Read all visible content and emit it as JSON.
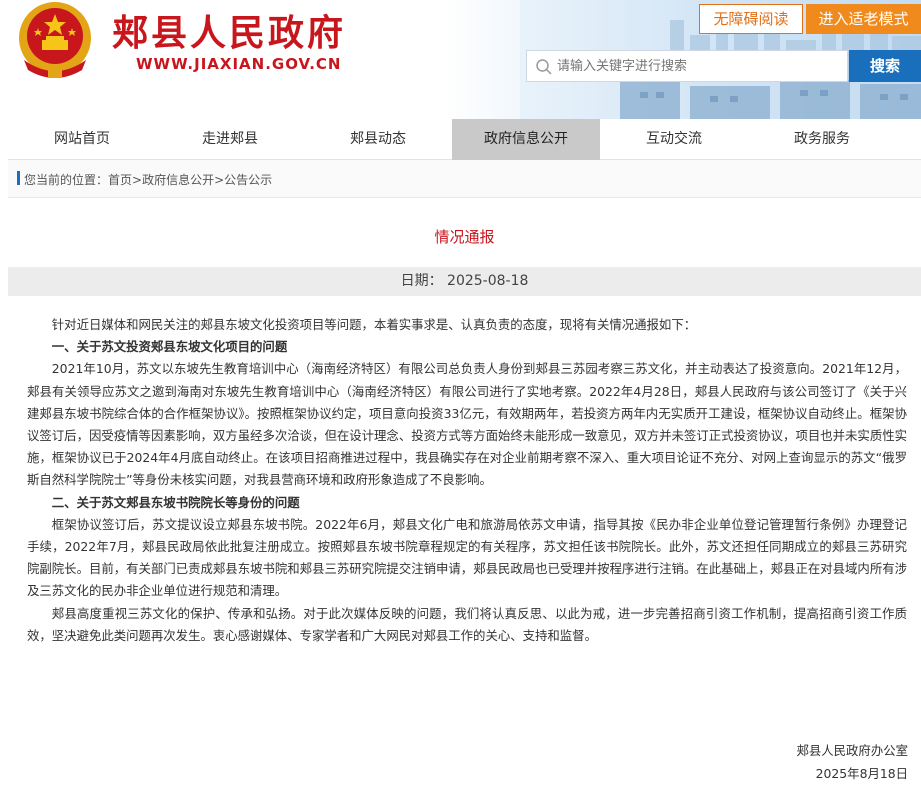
{
  "header": {
    "site_title": "郏县人民政府",
    "site_url": "WWW.JIAXIAN.GOV.CN",
    "accessibility_label": "无障碍阅读",
    "elder_mode_label": "进入适老模式",
    "search_placeholder": "请输入关键字进行搜索",
    "search_button": "搜索"
  },
  "nav": {
    "items": [
      "网站首页",
      "走进郏县",
      "郏县动态",
      "政府信息公开",
      "互动交流",
      "政务服务"
    ],
    "active": "政府信息公开"
  },
  "breadcrumb": {
    "prefix": "您当前的位置：",
    "items": [
      "首页",
      "政府信息公开",
      "公告公示"
    ],
    "separator": ">"
  },
  "article": {
    "title": "情况通报",
    "date": "日期：  2025-08-18",
    "paragraphs": [
      "针对近日媒体和网民关注的郏县东坡文化投资项目等问题，本着实事求是、认真负责的态度，现将有关情况通报如下：",
      "一、关于苏文投资郏县东坡文化项目的问题",
      "2021年10月，苏文以东坡先生教育培训中心（海南经济特区）有限公司总负责人身份到郏县三苏园考察三苏文化，并主动表达了投资意向。2021年12月，郏县有关领导应苏文之邀到海南对东坡先生教育培训中心（海南经济特区）有限公司进行了实地考察。2022年4月28日，郏县人民政府与该公司签订了《关于兴建郏县东坡书院综合体的合作框架协议》。按照框架协议约定，项目意向投资33亿元，有效期两年，若投资方两年内无实质开工建设，框架协议自动终止。框架协议签订后，因受疫情等因素影响，双方虽经多次洽谈，但在设计理念、投资方式等方面始终未能形成一致意见，双方并未签订正式投资协议，项目也并未实质性实施，框架协议已于2024年4月底自动终止。在该项目招商推进过程中，我县确实存在对企业前期考察不深入、重大项目论证不充分、对网上查询显示的苏文“俄罗斯自然科学院院士”等身份未核实问题，对我县营商环境和政府形象造成了不良影响。",
      "二、关于苏文郏县东坡书院院长等身份的问题",
      "框架协议签订后，苏文提议设立郏县东坡书院。2022年6月，郏县文化广电和旅游局依苏文申请，指导其按《民办非企业单位登记管理暂行条例》办理登记手续，2022年7月，郏县民政局依此批复注册成立。按照郏县东坡书院章程规定的有关程序，苏文担任该书院院长。此外，苏文还担任同期成立的郏县三苏研究院副院长。目前，有关部门已责成郏县东坡书院和郏县三苏研究院提交注销申请，郏县民政局也已受理并按程序进行注销。在此基础上，郏县正在对县域内所有涉及三苏文化的民办非企业单位进行规范和清理。",
      "郏县高度重视三苏文化的保护、传承和弘扬。对于此次媒体反映的问题，我们将认真反思、以此为戒，进一步完善招商引资工作机制，提高招商引资工作质效，坚决避免此类问题再次发生。衷心感谢媒体、专家学者和广大网民对郏县工作的关心、支持和监督。"
    ],
    "bold_paragraphs": [
      1,
      3
    ],
    "signature_org": "郏县人民政府办公室",
    "signature_date": "2025年8月18日"
  },
  "colors": {
    "brand_red": "#c8161d",
    "accent_blue": "#1a6fbd",
    "orange": "#f08a1d",
    "nav_active": "#c9c9c9"
  },
  "icons": [
    "national-emblem-icon",
    "search-icon",
    "city-skyline-image"
  ]
}
